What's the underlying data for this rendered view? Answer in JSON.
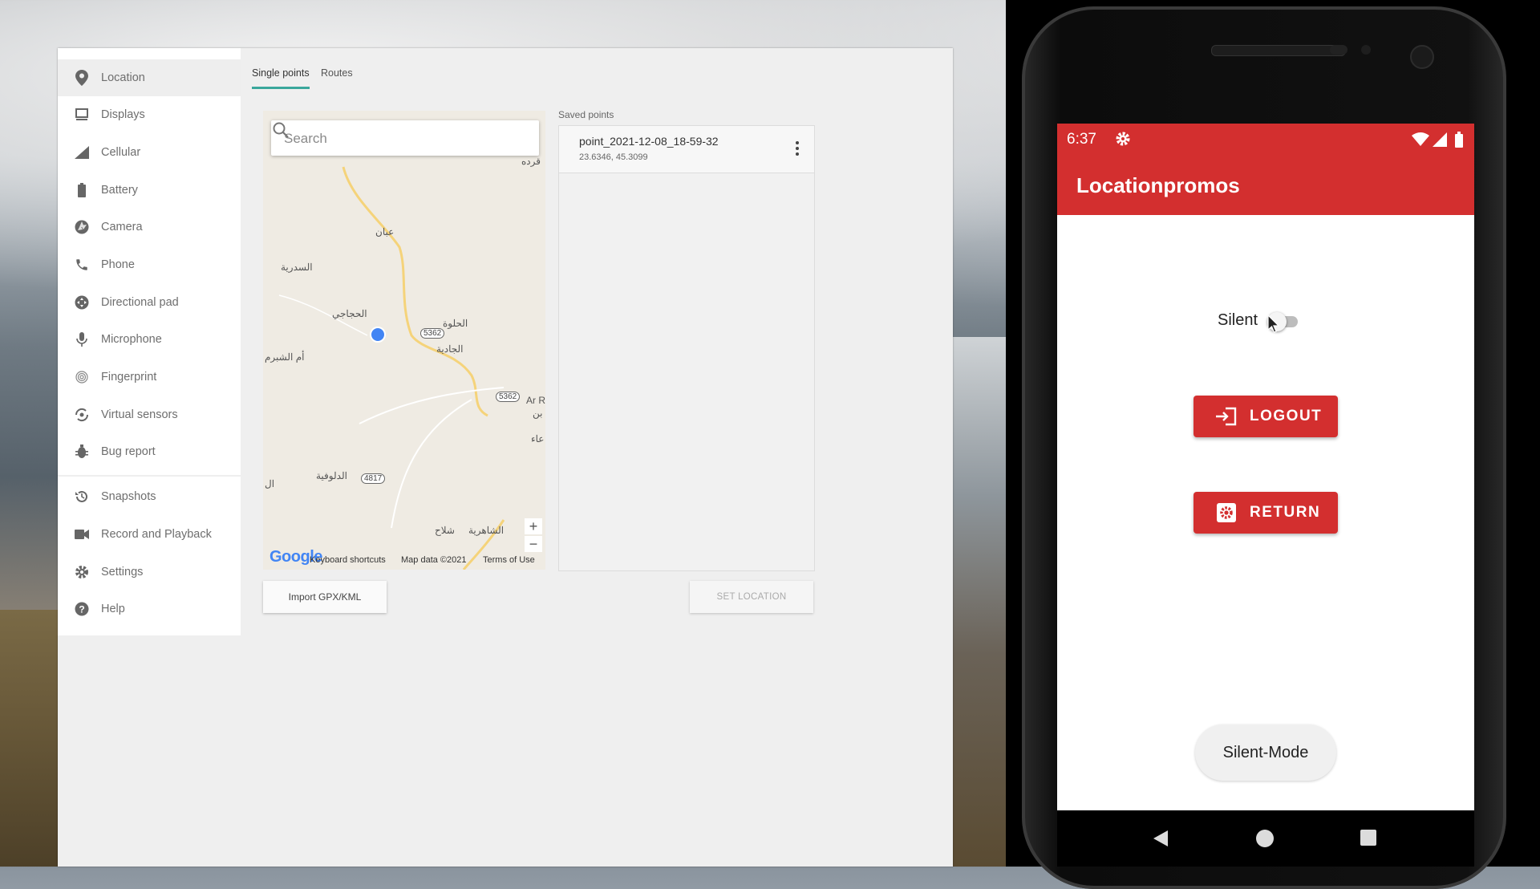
{
  "sidebar": {
    "items": [
      {
        "label": "Location",
        "icon": "location-pin-icon"
      },
      {
        "label": "Displays",
        "icon": "display-icon"
      },
      {
        "label": "Cellular",
        "icon": "signal-icon"
      },
      {
        "label": "Battery",
        "icon": "battery-icon"
      },
      {
        "label": "Camera",
        "icon": "camera-aperture-icon"
      },
      {
        "label": "Phone",
        "icon": "phone-icon"
      },
      {
        "label": "Directional pad",
        "icon": "dpad-icon"
      },
      {
        "label": "Microphone",
        "icon": "microphone-icon"
      },
      {
        "label": "Fingerprint",
        "icon": "fingerprint-icon"
      },
      {
        "label": "Virtual sensors",
        "icon": "rotate-sensor-icon"
      },
      {
        "label": "Bug report",
        "icon": "bug-icon"
      },
      {
        "label": "Snapshots",
        "icon": "history-icon"
      },
      {
        "label": "Record and Playback",
        "icon": "videocam-icon"
      },
      {
        "label": "Settings",
        "icon": "gear-icon"
      },
      {
        "label": "Help",
        "icon": "help-icon"
      }
    ]
  },
  "tabs": [
    {
      "label": "Single points",
      "active": true
    },
    {
      "label": "Routes",
      "active": false
    }
  ],
  "map": {
    "search_placeholder": "Search",
    "place_labels": [
      "عبان",
      "السدرية",
      "الحجاجي",
      "الحلوة",
      "الجادية",
      "أم الشبرم",
      "الدلوفية",
      "الشاهرية",
      "شلاح",
      "Ar R",
      "بن",
      "عاء",
      "قرده",
      "ال"
    ],
    "road_shields": [
      "5362",
      "5362",
      "4817"
    ],
    "zoom_in": "+",
    "zoom_out": "−",
    "logo": "Google",
    "footer": {
      "shortcuts": "Keyboard shortcuts",
      "map_data": "Map data ©2021",
      "terms": "Terms of Use"
    }
  },
  "saved_points": {
    "title": "Saved points",
    "items": [
      {
        "name": "point_2021-12-08_18-59-32",
        "coords": "23.6346, 45.3099"
      }
    ]
  },
  "buttons": {
    "import": "Import GPX/KML",
    "set_location": "SET LOCATION"
  },
  "phone": {
    "status_time": "6:37",
    "app_title": "Locationpromos",
    "silent_label": "Silent",
    "silent_on": false,
    "logout_label": "LOGOUT",
    "return_label": "RETURN",
    "silent_mode_label": "Silent-Mode",
    "accent_color": "#d32f2f"
  }
}
